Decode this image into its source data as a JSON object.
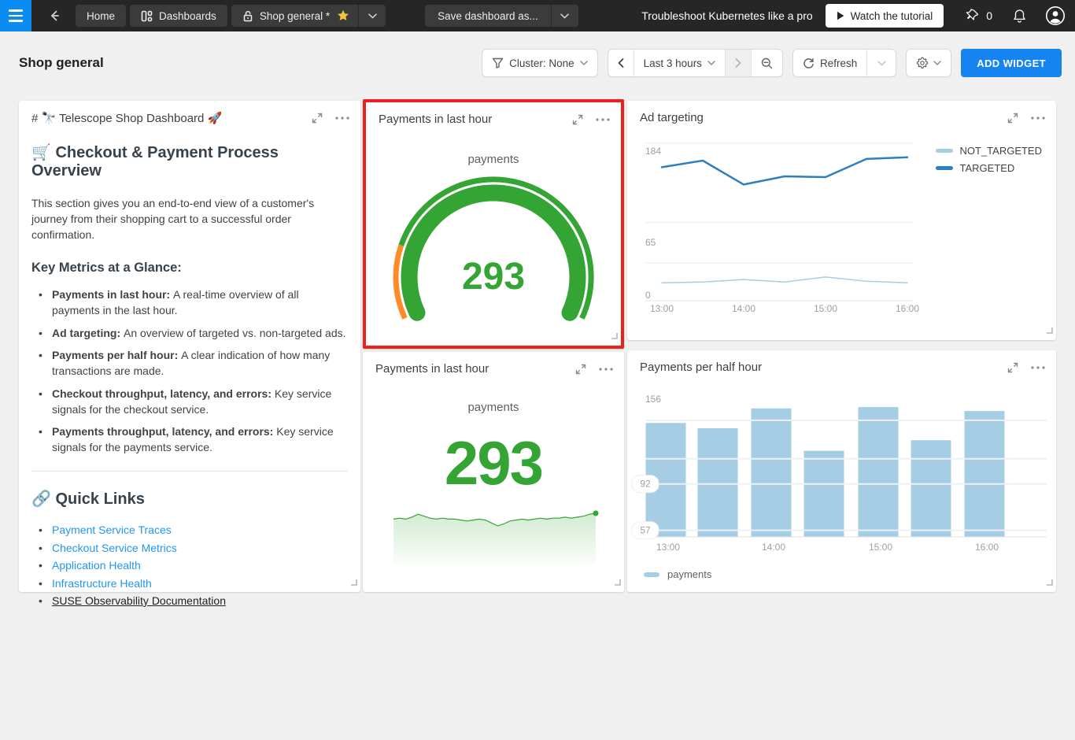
{
  "navbar": {
    "home": "Home",
    "dashboards": "Dashboards",
    "shop_general": "Shop general *",
    "save_dashboard": "Save dashboard as...",
    "promo_text": "Troubleshoot Kubernetes like a pro",
    "watch_button": "Watch the tutorial",
    "pin_count": "0"
  },
  "header": {
    "title": "Shop general",
    "cluster_filter": "Cluster: None",
    "time_range": "Last 3 hours",
    "refresh_label": "Refresh",
    "add_widget": "ADD WIDGET"
  },
  "markdown": {
    "title": "# 🔭 Telescope Shop Dashboard 🚀",
    "heading": "🛒 Checkout & Payment Process Overview",
    "intro": "This section gives you an end-to-end view of a customer's journey from their shopping cart to a successful order confirmation.",
    "metrics_heading": "Key Metrics at a Glance:",
    "bullets": [
      {
        "label": "Payments in last hour:",
        "text": "A real-time overview of all payments in the last hour."
      },
      {
        "label": "Ad targeting:",
        "text": "An overview of targeted vs. non-targeted ads."
      },
      {
        "label": "Payments per half hour:",
        "text": "A clear indication of how many transactions are made."
      },
      {
        "label": "Checkout throughput, latency, and errors:",
        "text": "Key service signals for the checkout service."
      },
      {
        "label": "Payments throughput, latency, and errors:",
        "text": "Key service signals for the payments service."
      }
    ],
    "quick_links_heading": "🔗 Quick Links",
    "links": [
      {
        "label": "Payment Service Traces",
        "style": "link"
      },
      {
        "label": "Checkout Service Metrics",
        "style": "link"
      },
      {
        "label": "Application Health",
        "style": "link"
      },
      {
        "label": "Infrastructure Health",
        "style": "link"
      },
      {
        "label": "SUSE Observability Documentation",
        "style": "plain"
      }
    ]
  },
  "widgets": {
    "gauge": {
      "title": "Payments in last hour",
      "metric": "payments",
      "value": "293"
    },
    "ad_targeting": {
      "title": "Ad targeting"
    },
    "big_number": {
      "title": "Payments in last hour",
      "metric": "payments",
      "value": "293"
    },
    "bar": {
      "title": "Payments per half hour"
    }
  },
  "chart_data": [
    {
      "id": "payments-gauge",
      "type": "gauge",
      "title": "Payments in last hour",
      "metric": "payments",
      "value": 293,
      "arc_color": "#34a434",
      "low_segment_color": "#ff8b26",
      "start_angle": 205,
      "end_angle": -25,
      "low_segment_end_angle": 161
    },
    {
      "id": "ad-targeting",
      "type": "line",
      "title": "Ad targeting",
      "x": [
        "13:00",
        "13:30",
        "14:00",
        "14:30",
        "15:00",
        "15:30",
        "16:00"
      ],
      "x_ticks": [
        "13:00",
        "14:00",
        "15:00",
        "16:00"
      ],
      "x_tick_indices": [
        0,
        2,
        4,
        6
      ],
      "y_ticks": [
        184,
        65,
        0
      ],
      "gridlines": [
        184,
        88,
        39
      ],
      "ylim": [
        0,
        184
      ],
      "legend_position": "right",
      "series": [
        {
          "name": "NOT_TARGETED",
          "color": "#a8cee4",
          "width": 1.5,
          "values": [
            15,
            16,
            19,
            16,
            22,
            17,
            15
          ]
        },
        {
          "name": "TARGETED",
          "color": "#2d7fc0",
          "width": 2.5,
          "values": [
            155,
            163,
            134,
            144,
            143,
            165,
            167
          ]
        }
      ]
    },
    {
      "id": "payments-big-number",
      "type": "big-number",
      "title": "Payments in last hour",
      "metric": "payments",
      "value": 293,
      "line_color": "#34a434",
      "sparkline": [
        292,
        293,
        292,
        294,
        297,
        295,
        293,
        292,
        293,
        292,
        292,
        291,
        290,
        291,
        292,
        291,
        288,
        285,
        287,
        290,
        291,
        292,
        291,
        292,
        293,
        292,
        293,
        293,
        294,
        293,
        294,
        295,
        297,
        298
      ]
    },
    {
      "id": "payments-per-half-hour",
      "type": "bar",
      "title": "Payments per half hour",
      "categories": [
        "13:00",
        "13:30",
        "14:00",
        "14:30",
        "15:00",
        "15:30",
        "16:00"
      ],
      "x_ticks": [
        "13:00",
        "14:00",
        "15:00",
        "16:00"
      ],
      "x_tick_indices": [
        0,
        2,
        4,
        6
      ],
      "values": [
        138,
        134,
        149,
        117,
        150,
        125,
        147
      ],
      "y_ticks": [
        {
          "value": 156,
          "pill": false
        },
        {
          "value": 92,
          "pill": true
        },
        {
          "value": 57,
          "pill": true
        }
      ],
      "gridlines": [
        140,
        111,
        92,
        57
      ],
      "ylim": [
        52,
        160
      ],
      "bar_color": "#a5cee4",
      "legend": [
        "payments"
      ],
      "legend_position": "bottom"
    }
  ]
}
